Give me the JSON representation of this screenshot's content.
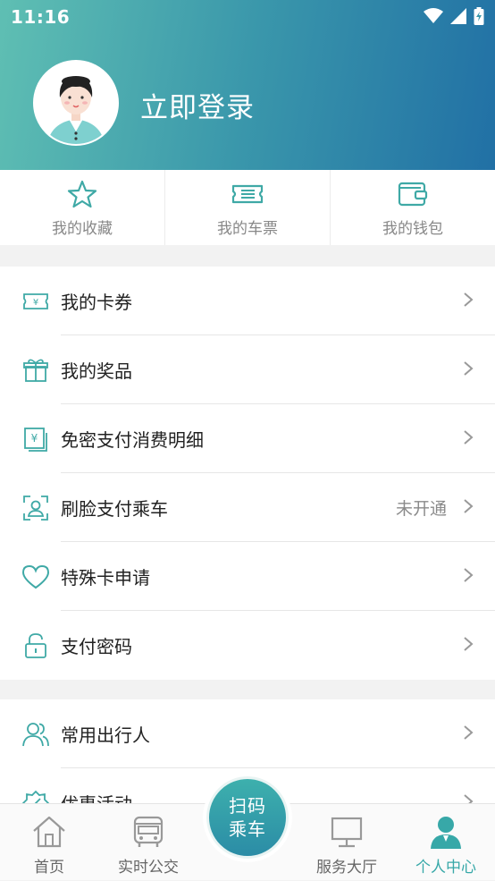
{
  "status_bar": {
    "time": "11:16"
  },
  "header": {
    "login_label": "立即登录"
  },
  "quick_actions": [
    {
      "label": "我的收藏",
      "icon": "star-icon"
    },
    {
      "label": "我的车票",
      "icon": "ticket-icon"
    },
    {
      "label": "我的钱包",
      "icon": "wallet-icon"
    }
  ],
  "section1": [
    {
      "label": "我的卡券",
      "icon": "coupon-icon",
      "extra": ""
    },
    {
      "label": "我的奖品",
      "icon": "gift-icon",
      "extra": ""
    },
    {
      "label": "免密支付消费明细",
      "icon": "bill-icon",
      "extra": ""
    },
    {
      "label": "刷脸支付乘车",
      "icon": "face-scan-icon",
      "extra": "未开通"
    },
    {
      "label": "特殊卡申请",
      "icon": "heart-icon",
      "extra": ""
    },
    {
      "label": "支付密码",
      "icon": "lock-icon",
      "extra": ""
    }
  ],
  "section2": [
    {
      "label": "常用出行人",
      "icon": "travelers-icon",
      "extra": ""
    },
    {
      "label": "优惠活动",
      "icon": "promotion-icon",
      "extra": ""
    }
  ],
  "bottom_nav": {
    "home": "首页",
    "realtime_bus": "实时公交",
    "scan": {
      "line1": "扫码",
      "line2": "乘车"
    },
    "service_hall": "服务大厅",
    "personal_center": "个人中心"
  },
  "colors": {
    "accent": "#37a8a8",
    "header_start": "#5fbfb3",
    "header_end": "#2170a5",
    "icon_teal": "#3fa9a6"
  }
}
